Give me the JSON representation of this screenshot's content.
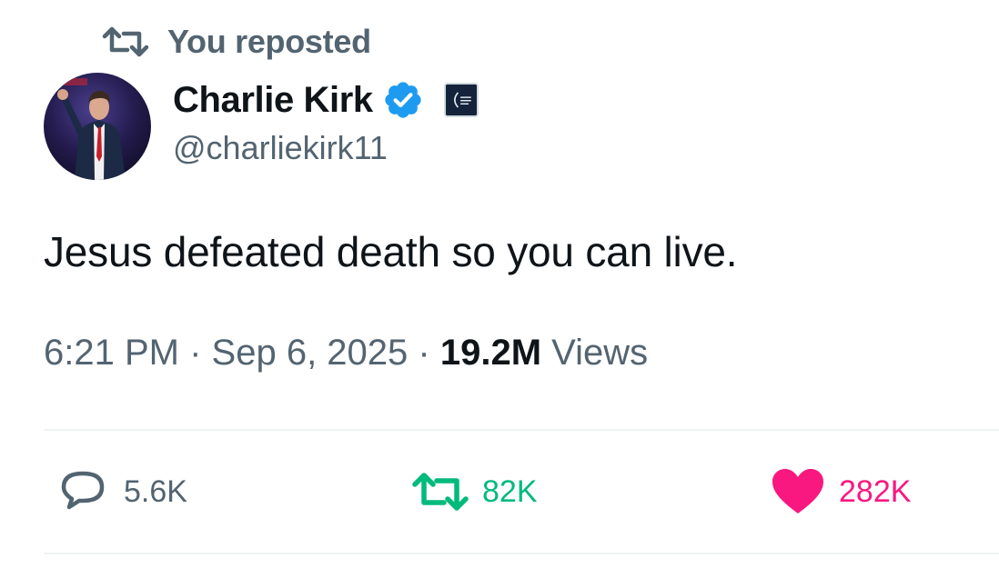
{
  "repost_context": {
    "icon": "repost-icon",
    "text": "You reposted"
  },
  "author": {
    "display_name": "Charlie Kirk",
    "handle": "@charliekirk11",
    "verified_icon": "verified-badge-icon",
    "affiliate_icon": "affiliate-badge-icon",
    "avatar": "avatar-photo"
  },
  "tweet": {
    "text": "Jesus defeated death so you can live.",
    "time": "6:21 PM",
    "date": "Sep 6, 2025",
    "separator": "·",
    "views_count": "19.2M",
    "views_label": "Views"
  },
  "actions": {
    "reply": {
      "icon": "reply-icon",
      "count": "5.6K",
      "color": "#536471"
    },
    "repost": {
      "icon": "repost-icon",
      "count": "82K",
      "color": "#00ba7c"
    },
    "like": {
      "icon": "heart-icon",
      "count": "282K",
      "color": "#f91880"
    }
  },
  "colors": {
    "text_primary": "#0f1419",
    "text_secondary": "#536471",
    "verified_blue": "#1d9bf0",
    "divider": "#eff3f4"
  }
}
